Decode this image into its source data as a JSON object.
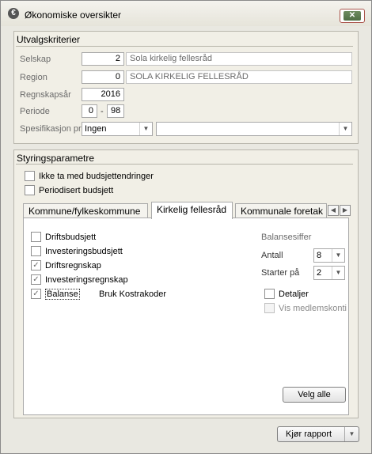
{
  "window": {
    "title": "Økonomiske oversikter",
    "close_symbol": "✕",
    "app_icon_symbol": "€"
  },
  "utvalg": {
    "title": "Utvalgskriterier",
    "selskap": {
      "label": "Selskap",
      "value": "2",
      "name": "Sola kirkelig fellesråd"
    },
    "region": {
      "label": "Region",
      "value": "0",
      "name": "SOLA KIRKELIG FELLESRÅD"
    },
    "regnskapsar": {
      "label": "Regnskapsår",
      "value": "2016"
    },
    "periode": {
      "label": "Periode",
      "from": "0",
      "separator": "-",
      "to": "98"
    },
    "spesifikasjon": {
      "label": "Spesifikasjon pr",
      "value": "Ingen",
      "second_value": ""
    }
  },
  "styring": {
    "title": "Styringsparametre",
    "ikke_budsjett": {
      "label": "Ikke ta med budsjettendringer",
      "checked": false
    },
    "periodisert": {
      "label": "Periodisert budsjett",
      "checked": false
    }
  },
  "tabs": {
    "items": [
      "Kommune/fylkeskommune",
      "Kirkelig fellesråd",
      "Kommunale foretak"
    ],
    "active_index": 1
  },
  "tab_content": {
    "checks": [
      {
        "label": "Driftsbudsjett",
        "checked": false
      },
      {
        "label": "Investeringsbudsjett",
        "checked": false
      },
      {
        "label": "Driftsregnskap",
        "checked": true
      },
      {
        "label": "Investeringsregnskap",
        "checked": true
      },
      {
        "label": "Balanse",
        "checked": true
      }
    ],
    "bruk_kostrakoder": "Bruk Kostrakoder",
    "balansesiffer_title": "Balansesiffer",
    "antall": {
      "label": "Antall",
      "value": "8"
    },
    "starter_pa": {
      "label": "Starter på",
      "value": "2"
    },
    "detaljer": {
      "label": "Detaljer",
      "checked": false
    },
    "vis_medlemskonti": {
      "label": "Vis medlemskonti",
      "checked": false
    },
    "velg_alle": "Velg alle"
  },
  "footer": {
    "kjor_rapport": "Kjør rapport"
  }
}
